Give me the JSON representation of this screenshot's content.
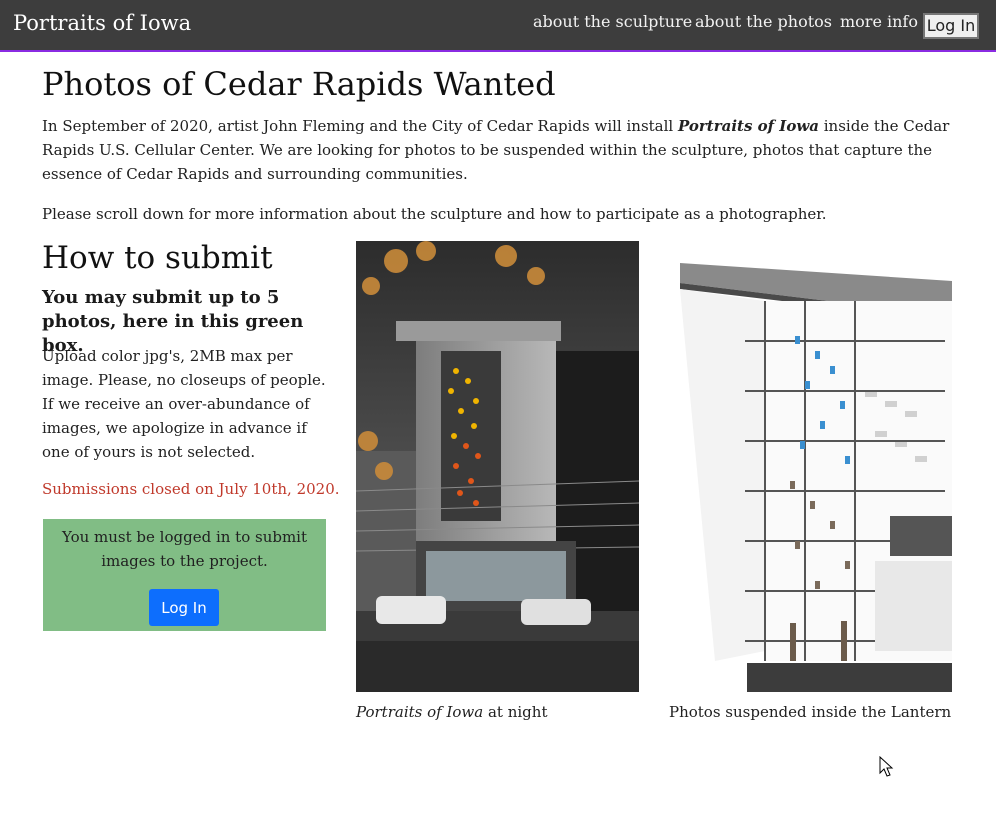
{
  "nav": {
    "brand": "Portraits of Iowa",
    "links": [
      "about the sculpture",
      "about the photos",
      "more info"
    ],
    "login": "Log In"
  },
  "main": {
    "title": "Photos of Cedar Rapids Wanted",
    "intro": {
      "pre": "In September of 2020, artist John Fleming and the City of Cedar Rapids will install ",
      "em": "Portraits of Iowa",
      "post": " inside the Cedar Rapids U.S. Cellular Center. We are looking for photos to be suspended within the sculpture, photos that capture the essence of Cedar Rapids and surrounding communities."
    },
    "intro2": "Please scroll down for more information about the sculpture and how to participate as a photographer."
  },
  "submit": {
    "heading": "How to submit",
    "subheading": "You may submit up to 5 photos, here in this green box.",
    "instructions": "Upload color jpg's, 2MB max per image. Please, no closeups of people. If we receive an over-abundance of images, we apologize in advance if one of yours is not selected.",
    "closed": "Submissions closed on July 10th, 2020.",
    "login_msg": "You must be logged in to submit images to the project.",
    "login_button": "Log In"
  },
  "photos": [
    {
      "caption_em": "Portraits of Iowa",
      "caption_rest": " at night"
    },
    {
      "caption": "Photos suspended inside the Lantern"
    }
  ],
  "colors": {
    "navbar": "#3d3d3d",
    "nav_underline": "#8a2be2",
    "green_box": "#81bd85",
    "login_button": "#0d6efd",
    "closed_text": "#c0392b"
  }
}
